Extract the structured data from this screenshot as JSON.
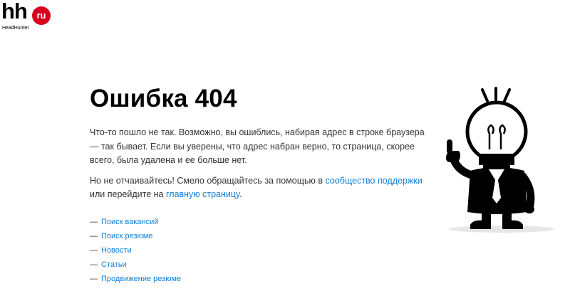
{
  "logo": {
    "mark": "hh",
    "badge": "ru",
    "subtitle": "HeadHunter",
    "brand_color": "#d6001c"
  },
  "error": {
    "title": "Ошибка 404",
    "paragraph1": "Что-то пошло не так. Возможно, вы ошиблись, набирая адрес в строке браузера — так бывает. Если вы уверены, что адрес набран верно, то страница, скорее всего, была удалена и ее больше нет.",
    "paragraph2_before": "Но не отчаивайтесь! Смело обращайтесь за помощью в ",
    "support_link": "сообщество поддержки",
    "paragraph2_middle": " или перейдите на ",
    "home_link": "главную страницу",
    "paragraph2_end": "."
  },
  "links": {
    "dash": "—",
    "items": [
      {
        "label": "Поиск вакансий"
      },
      {
        "label": "Поиск резюме"
      },
      {
        "label": "Новости"
      },
      {
        "label": "Статьи"
      },
      {
        "label": "Продвижение резюме"
      }
    ]
  },
  "colors": {
    "link": "#0f7ed6",
    "text": "#333333",
    "title": "#000000"
  },
  "illustration": {
    "icon": "lightbulb-man-icon"
  }
}
